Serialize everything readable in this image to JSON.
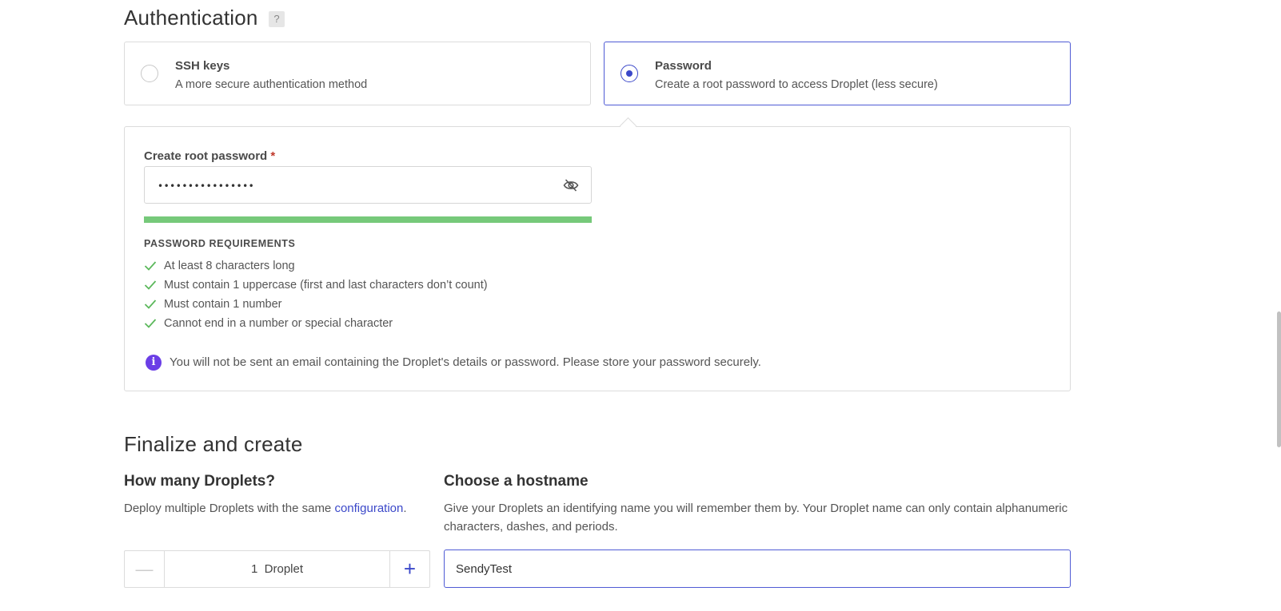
{
  "authentication": {
    "heading": "Authentication",
    "help_badge": "?",
    "options": [
      {
        "title": "SSH keys",
        "description": "A more secure authentication method",
        "selected": false
      },
      {
        "title": "Password",
        "description": "Create a root password to access Droplet (less secure)",
        "selected": true
      }
    ],
    "password_panel": {
      "label": "Create root password",
      "required_mark": "*",
      "value": "••••••••••••••••",
      "strength_percent": 100,
      "strength_color": "#76c97a",
      "requirements_title": "PASSWORD REQUIREMENTS",
      "requirements": [
        "At least 8 characters long",
        "Must contain 1 uppercase (first and last characters don’t count)",
        "Must contain 1 number",
        "Cannot end in a number or special character"
      ],
      "notice_icon": "i",
      "notice": "You will not be sent an email containing the Droplet's details or password. Please store your password securely."
    }
  },
  "finalize": {
    "heading": "Finalize and create",
    "droplets": {
      "title": "How many Droplets?",
      "description_prefix": "Deploy multiple Droplets with the same ",
      "description_link": "configuration",
      "description_suffix": ".",
      "count": "1",
      "unit": "Droplet",
      "minus": "—",
      "plus": "+"
    },
    "hostname": {
      "title": "Choose a hostname",
      "description": "Give your Droplets an identifying name you will remember them by. Your Droplet name can only contain alphanumeric characters, dashes, and periods.",
      "value": "SendyTest"
    }
  },
  "colors": {
    "accent": "#3b48c9",
    "check": "#5cb85c",
    "info": "#6b3ee6"
  }
}
